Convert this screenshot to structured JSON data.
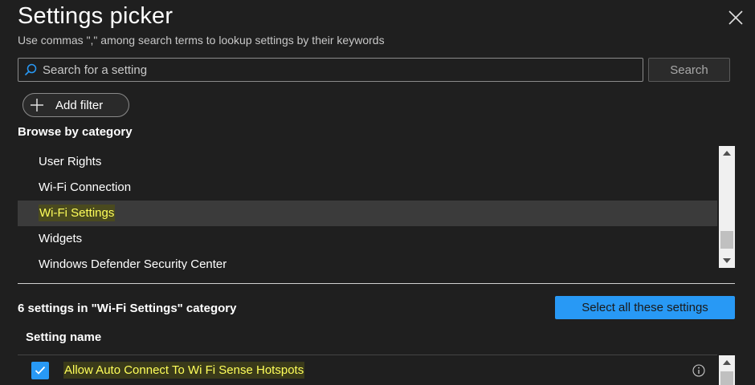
{
  "dialog": {
    "title": "Settings picker",
    "subtitle": "Use commas \",\" among search terms to lookup settings by their keywords"
  },
  "search": {
    "placeholder": "Search for a setting",
    "value": "",
    "button_label": "Search"
  },
  "filter": {
    "add_filter_label": "Add filter"
  },
  "browse": {
    "heading": "Browse by category",
    "items": [
      {
        "label": "User Rights",
        "selected": false
      },
      {
        "label": "Wi-Fi Connection",
        "selected": false
      },
      {
        "label": "Wi-Fi Settings",
        "selected": true
      },
      {
        "label": "Widgets",
        "selected": false
      },
      {
        "label": "Windows Defender Security Center",
        "selected": false
      }
    ]
  },
  "results": {
    "count_text": "6 settings in \"Wi-Fi Settings\" category",
    "select_all_label": "Select all these settings",
    "column_header": "Setting name",
    "rows": [
      {
        "label": "Allow Auto Connect To Wi Fi Sense Hotspots",
        "checked": true
      }
    ]
  },
  "colors": {
    "accent": "#2899f5",
    "highlight_text": "#ffff5a",
    "background": "#1f1f1f",
    "selected_row": "#3b3b3b"
  },
  "icons": {
    "close": "close-icon",
    "search": "search-icon",
    "add": "plus-icon",
    "check": "check-icon",
    "info": "info-icon",
    "scroll_up": "chevron-up-icon",
    "scroll_down": "chevron-down-icon"
  }
}
